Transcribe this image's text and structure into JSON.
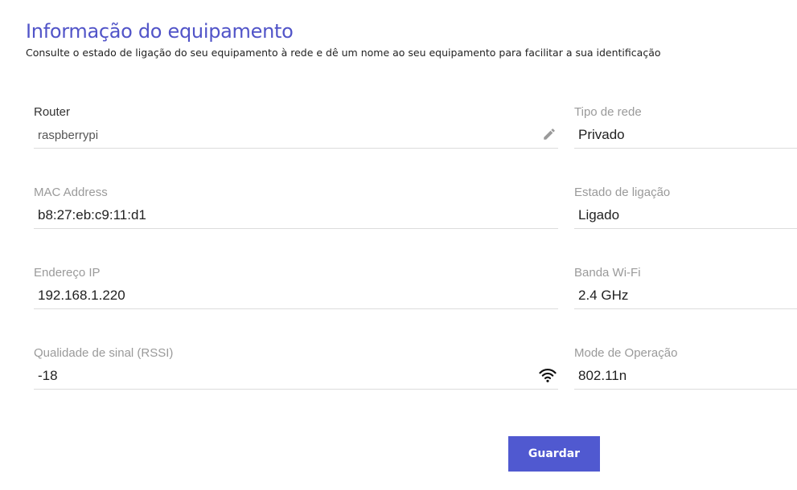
{
  "header": {
    "title": "Informação do equipamento",
    "subtitle": "Consulte o estado de ligação do seu equipamento à rede e dê um nome ao seu equipamento para facilitar a sua identificação"
  },
  "fields": {
    "router": {
      "label": "Router",
      "value": "raspberrypi",
      "icon": "pencil-icon"
    },
    "mac": {
      "label": "MAC Address",
      "value": "b8:27:eb:c9:11:d1"
    },
    "ip": {
      "label": "Endereço IP",
      "value": "192.168.1.220"
    },
    "rssi": {
      "label": "Qualidade de sinal (RSSI)",
      "value": "-18",
      "icon": "wifi-icon"
    },
    "network_type": {
      "label": "Tipo de rede",
      "value": "Privado"
    },
    "connection_state": {
      "label": "Estado de ligação",
      "value": "Ligado"
    },
    "wifi_band": {
      "label": "Banda Wi-Fi",
      "value": "2.4 GHz"
    },
    "operation_mode": {
      "label": "Mode de Operação",
      "value": "802.11n"
    }
  },
  "actions": {
    "save_label": "Guardar"
  },
  "colors": {
    "accent": "#5154c8",
    "button": "#5059d0"
  }
}
